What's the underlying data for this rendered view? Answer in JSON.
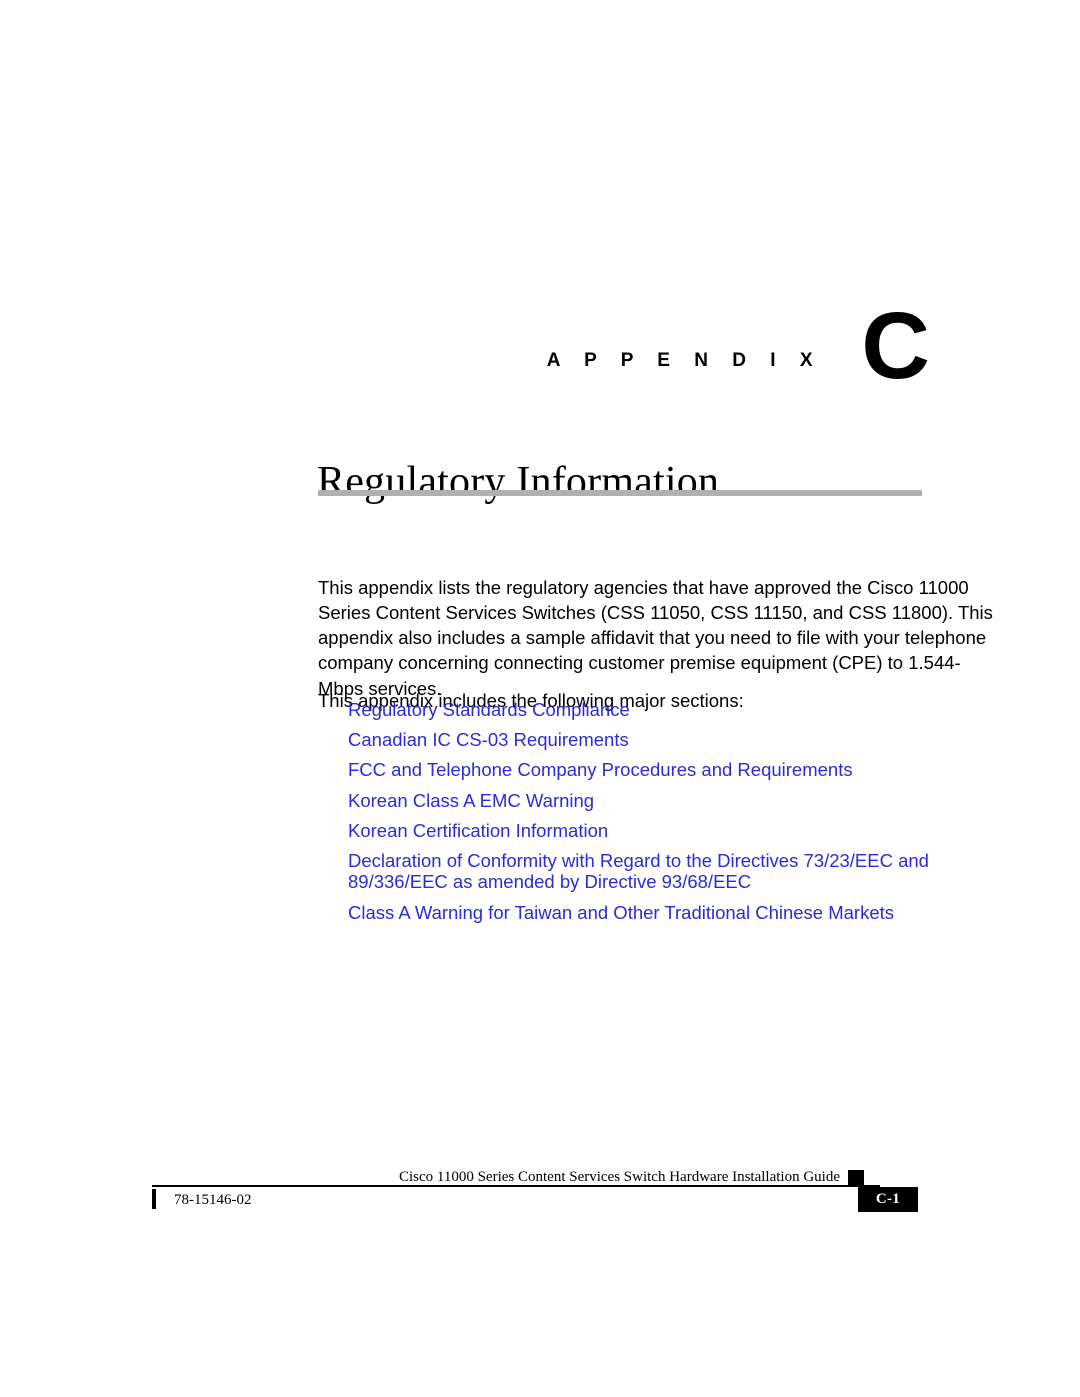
{
  "appendix": {
    "word": "A P P E N D I X",
    "letter": "C"
  },
  "title": "Regulatory Information",
  "body": {
    "intro_paragraph": "This appendix lists the regulatory agencies that have approved the Cisco 11000 Series Content Services Switches (CSS 11050, CSS 11150, and CSS 11800). This appendix also includes a sample affidavit that you need to file with your telephone company concerning connecting customer premise equipment (CPE) to 1.544-Mbps services.",
    "sections_lead": "This appendix includes the following major sections:"
  },
  "section_links": [
    {
      "label": "Regulatory Standards Compliance"
    },
    {
      "label": "Canadian IC CS-03 Requirements"
    },
    {
      "label": "FCC and Telephone Company Procedures and Requirements"
    },
    {
      "label": "Korean Class A EMC Warning"
    },
    {
      "label": "Korean Certification Information"
    },
    {
      "label": "Declaration of Conformity with Regard to the Directives 73/23/EEC and\n89/336/EEC as amended by Directive 93/68/EEC"
    },
    {
      "label": "Class A Warning for Taiwan and Other Traditional Chinese Markets"
    }
  ],
  "footer": {
    "guide_title": "Cisco 11000 Series Content Services Switch Hardware Installation Guide",
    "doc_number": "78-15146-02",
    "page_number": "C-1"
  },
  "colors": {
    "link_blue": "#2b2bd8",
    "title_rule_gray": "#b0b0b0",
    "text_black": "#000000",
    "page_background": "#ffffff"
  }
}
